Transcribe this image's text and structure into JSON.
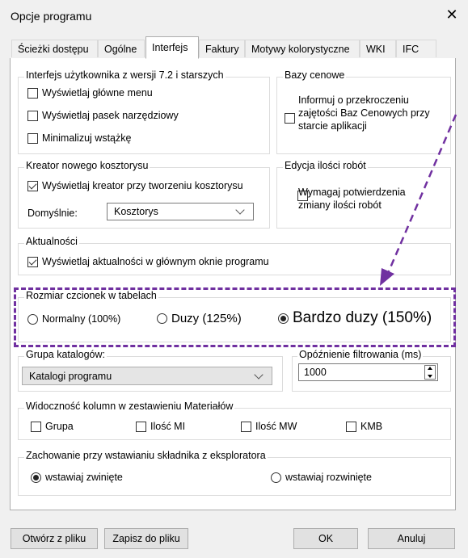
{
  "window": {
    "title": "Opcje programu"
  },
  "tabs": [
    "Ścieżki dostępu",
    "Ogólne",
    "Interfejs",
    "Faktury",
    "Motywy kolorystyczne",
    "WKI",
    "IFC"
  ],
  "interface_group": {
    "legend": "Interfejs użytkownika z wersji 7.2 i starszych",
    "items": [
      {
        "label": "Wyświetlaj główne menu",
        "checked": false
      },
      {
        "label": "Wyświetlaj pasek narzędziowy",
        "checked": false
      },
      {
        "label": "Minimalizuj wstążkę",
        "checked": false
      }
    ]
  },
  "price_bases": {
    "legend": "Bazy cenowe",
    "label_lines": [
      "Informuj o przekroczeniu",
      "zajętości Baz Cenowych przy",
      "starcie aplikacji"
    ],
    "checked": false
  },
  "estimate_wizard": {
    "legend": "Kreator nowego kosztorysu",
    "show_label": "Wyświetlaj kreator przy tworzeniu kosztorysu",
    "show_checked": true,
    "default_label": "Domyślnie:",
    "default_value": "Kosztorys"
  },
  "qty_edit": {
    "legend": "Edycja ilości robót",
    "label_lines": [
      "Wymagaj potwierdzenia",
      "zmiany ilości robót"
    ],
    "checked": false
  },
  "news": {
    "legend": "Aktualności",
    "label": "Wyświetlaj aktualności w głównym oknie programu",
    "checked": true
  },
  "font_size": {
    "legend": "Rozmiar czcionek w tabelach",
    "options": [
      "Normalny (100%)",
      "Duzy (125%)",
      "Bardzo duzy (150%)"
    ],
    "selected_index": 2,
    "highlight_color": "#7030a0"
  },
  "catalog_group": {
    "legend": "Grupa katalogów:",
    "value": "Katalogi programu"
  },
  "filter_delay": {
    "legend": "Opóźnienie filtrowania (ms)",
    "value": "1000"
  },
  "columns": {
    "legend": "Widoczność kolumn w zestawieniu Materiałów",
    "items": [
      "Grupa",
      "Ilość MI",
      "Ilość MW",
      "KMB"
    ]
  },
  "insert_behavior": {
    "legend": "Zachowanie przy wstawianiu składnika z eksploratora",
    "options": [
      "wstawiaj zwinięte",
      "wstawiaj rozwinięte"
    ],
    "selected_index": 0
  },
  "buttons": {
    "load": "Otwórz z pliku",
    "save": "Zapisz do pliku",
    "ok": "OK",
    "cancel": "Anuluj"
  }
}
